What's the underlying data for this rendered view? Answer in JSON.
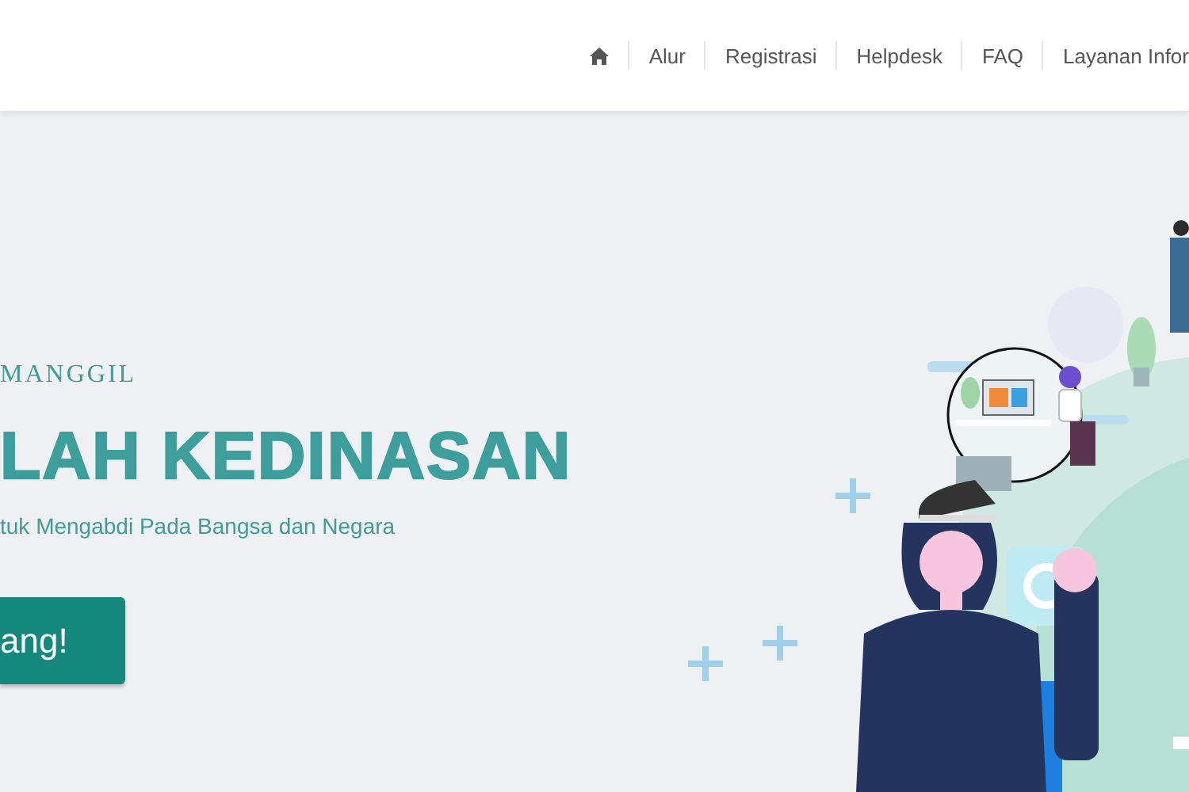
{
  "nav": {
    "items": [
      {
        "kind": "home"
      },
      {
        "kind": "text",
        "label": "Alur"
      },
      {
        "kind": "text",
        "label": "Registrasi"
      },
      {
        "kind": "text",
        "label": "Helpdesk"
      },
      {
        "kind": "text",
        "label": "FAQ"
      },
      {
        "kind": "text",
        "label": "Layanan Infor"
      }
    ]
  },
  "hero": {
    "eyebrow": "MANGGIL",
    "title": "LAH KEDINASAN",
    "subtitle": "tuk Mengabdi Pada Bangsa dan Negara",
    "button": "ang!"
  }
}
